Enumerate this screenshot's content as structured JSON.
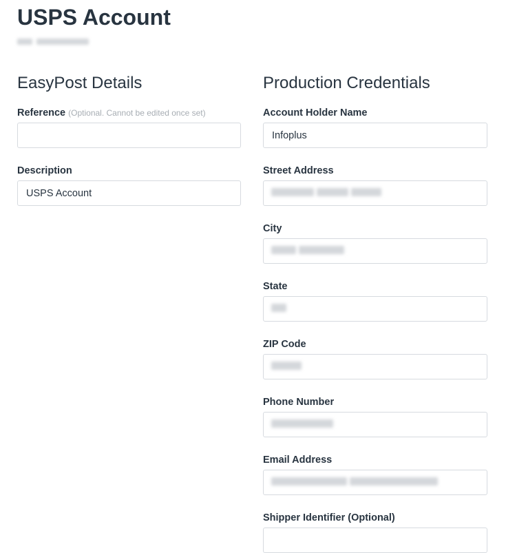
{
  "header": {
    "title": "USPS Account"
  },
  "easypost_details": {
    "heading": "EasyPost Details",
    "reference": {
      "label": "Reference",
      "hint": "(Optional. Cannot be edited once set)",
      "value": ""
    },
    "description": {
      "label": "Description",
      "value": "USPS Account"
    }
  },
  "production_credentials": {
    "heading": "Production Credentials",
    "account_holder_name": {
      "label": "Account Holder Name",
      "value": "Infoplus"
    },
    "street_address": {
      "label": "Street Address"
    },
    "city": {
      "label": "City"
    },
    "state": {
      "label": "State"
    },
    "zip_code": {
      "label": "ZIP Code"
    },
    "phone_number": {
      "label": "Phone Number"
    },
    "email_address": {
      "label": "Email Address"
    },
    "shipper_identifier": {
      "label": "Shipper Identifier (Optional)",
      "value": ""
    }
  }
}
